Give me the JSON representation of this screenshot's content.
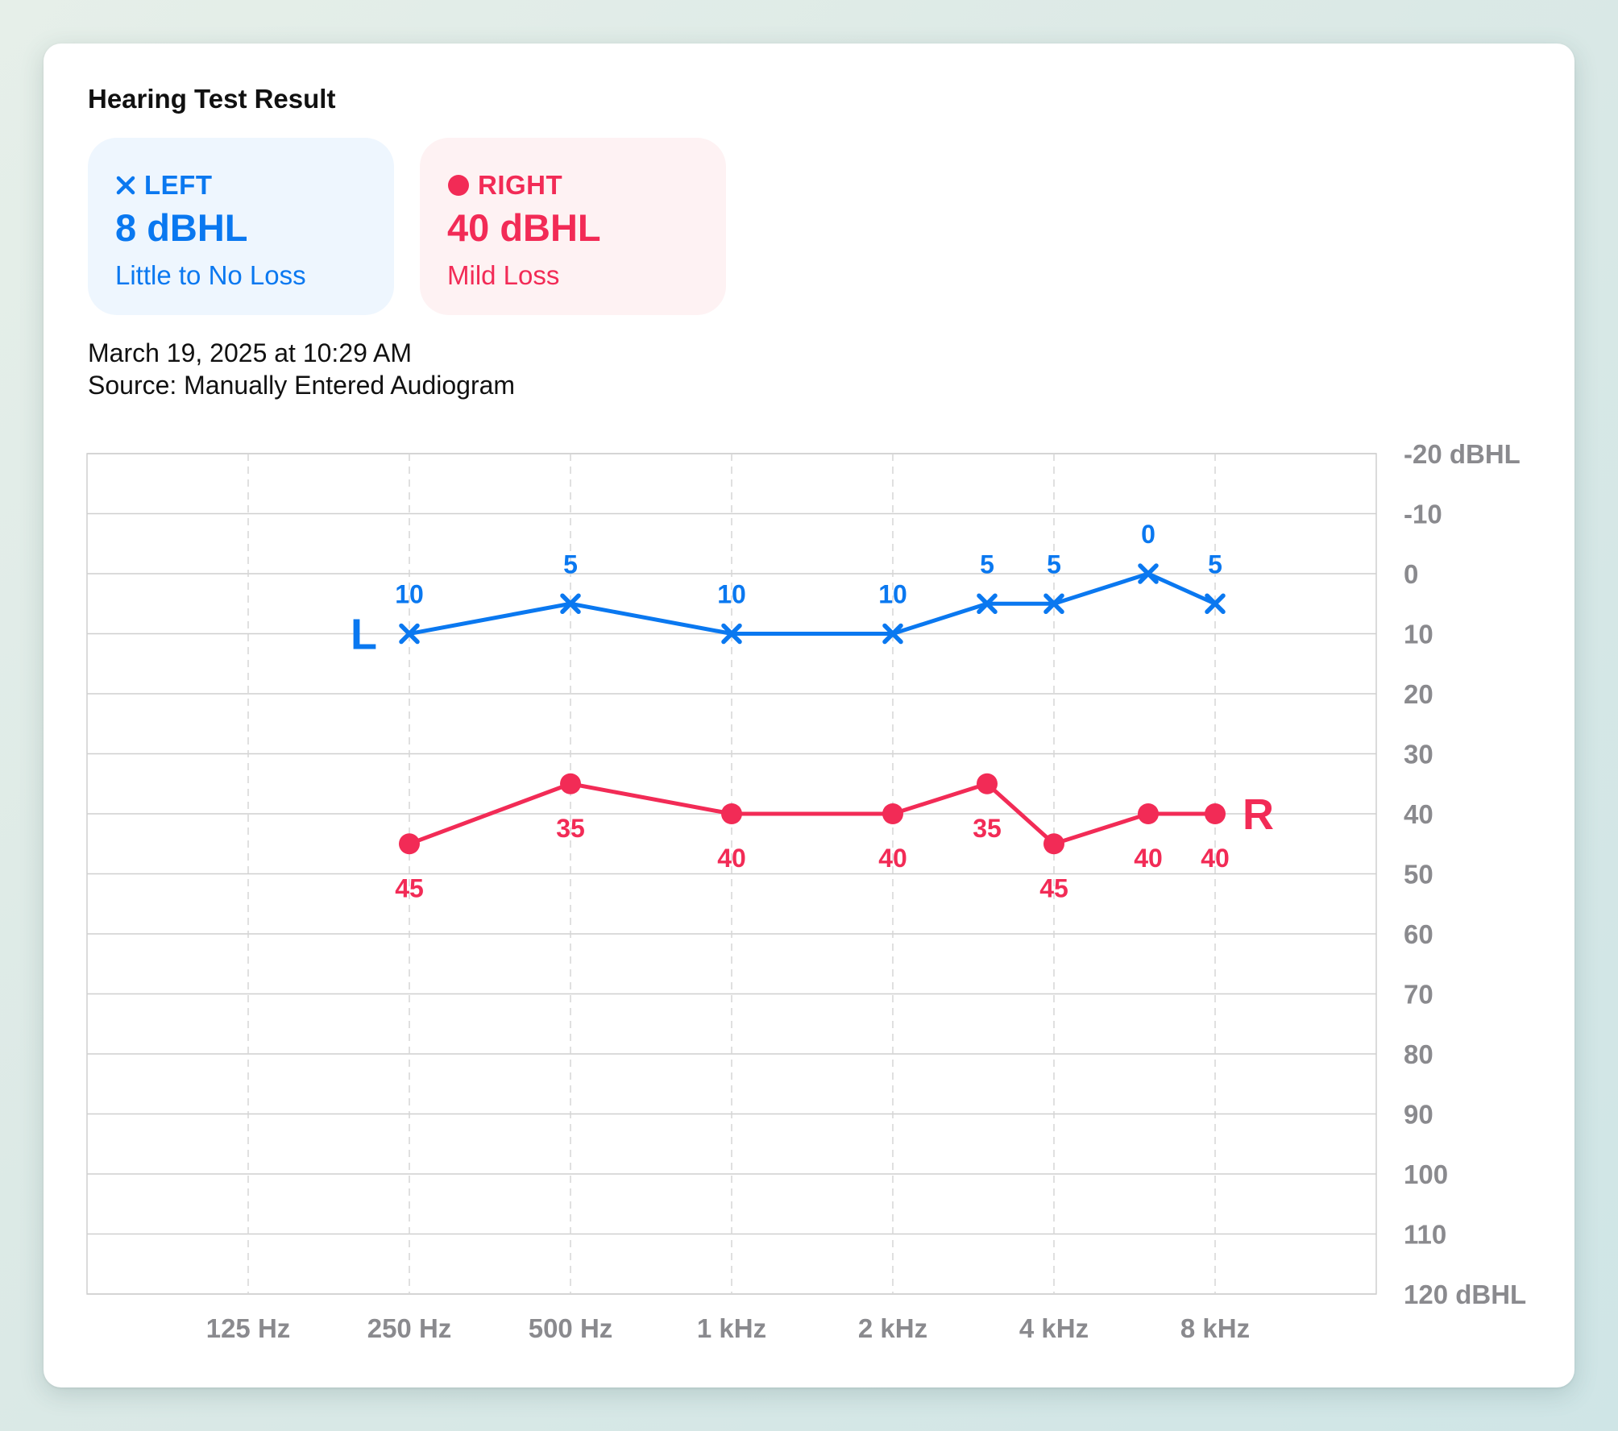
{
  "card": {
    "title": "Hearing Test Result",
    "date": "March 19, 2025 at 10:29 AM",
    "source": "Source: Manually Entered Audiogram"
  },
  "left_ear": {
    "icon": "x-mark-icon",
    "label": "LEFT",
    "value": "8 dBHL",
    "description": "Little to No Loss",
    "color": "#0a78f0",
    "marker_label": "L"
  },
  "right_ear": {
    "icon": "filled-circle-icon",
    "label": "RIGHT",
    "value": "40 dBHL",
    "description": "Mild Loss",
    "color": "#f22b56",
    "marker_label": "R"
  },
  "chart_data": {
    "type": "line",
    "x_scale": "log",
    "y_inverted": true,
    "ylim": [
      -20,
      120
    ],
    "y_ticks": [
      -20,
      -10,
      0,
      10,
      20,
      30,
      40,
      50,
      60,
      70,
      80,
      90,
      100,
      110,
      120
    ],
    "y_tick_labels": [
      "-20 dBHL",
      "-10",
      "0",
      "10",
      "20",
      "30",
      "40",
      "50",
      "60",
      "70",
      "80",
      "90",
      "100",
      "110",
      "120 dBHL"
    ],
    "xlim": [
      62.5,
      16000
    ],
    "x_ticks": [
      125,
      250,
      500,
      1000,
      2000,
      4000,
      8000
    ],
    "x_tick_labels": [
      "125 Hz",
      "250 Hz",
      "500 Hz",
      "1 kHz",
      "2 kHz",
      "4 kHz",
      "8 kHz"
    ],
    "grid": true,
    "series": [
      {
        "name": "L",
        "marker": "x",
        "color": "#0a78f0",
        "x": [
          250,
          500,
          1000,
          2000,
          3000,
          4000,
          6000,
          8000
        ],
        "values": [
          10,
          5,
          10,
          10,
          5,
          5,
          0,
          5
        ]
      },
      {
        "name": "R",
        "marker": "circle",
        "color": "#f22b56",
        "x": [
          250,
          500,
          1000,
          2000,
          3000,
          4000,
          6000,
          8000
        ],
        "values": [
          45,
          35,
          40,
          40,
          35,
          45,
          40,
          40
        ]
      }
    ]
  }
}
